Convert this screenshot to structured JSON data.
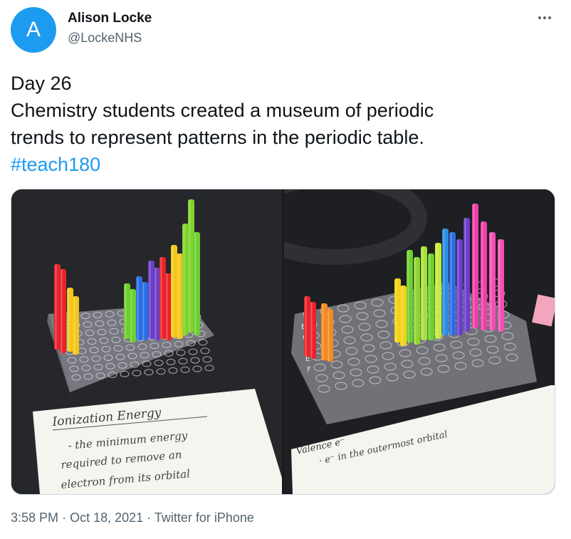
{
  "author": {
    "avatar_letter": "A",
    "display_name": "Alison Locke",
    "handle": "@LockeNHS"
  },
  "tweet": {
    "lines": [
      "Day 26",
      "Chemistry students created a museum of periodic",
      "trends to represent patterns in the periodic table."
    ],
    "hashtag": "#teach180"
  },
  "media": {
    "left_photo": {
      "description_icon": "straws-in-well-plate-photo",
      "card_title": "Ionization Energy",
      "card_lines": [
        "- the minimum energy",
        "required to remove an",
        "electron from its orbital"
      ]
    },
    "right_photo": {
      "description_icon": "straws-in-well-plate-photo",
      "card_title": "Valence e⁻",
      "card_line": "· e⁻ in the outermost orbital",
      "plate_rows": [
        "B",
        "C",
        "D",
        "E",
        "F"
      ]
    }
  },
  "footer": {
    "time": "3:58 PM",
    "separator": "·",
    "date": "Oct 18, 2021",
    "source": "Twitter for iPhone"
  },
  "colors": {
    "link": "#1d9bf0",
    "secondary_text": "#536471",
    "primary_text": "#0f1419"
  }
}
